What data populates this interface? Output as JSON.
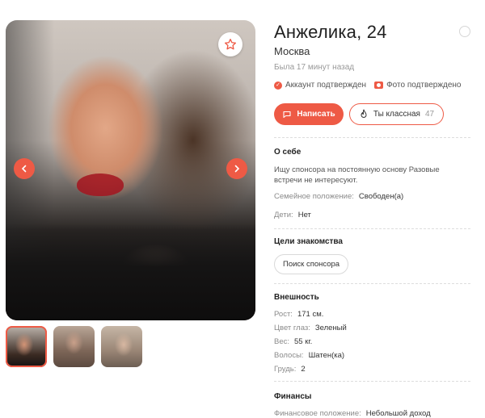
{
  "profile": {
    "name_age": "Анжелика, 24",
    "city": "Москва",
    "last_seen": "Была 17 минут назад",
    "badges": {
      "account_verified": "Аккаунт подтвержден",
      "photo_verified": "Фото подтверждено"
    }
  },
  "actions": {
    "write_label": "Написать",
    "cool_label": "Ты классная",
    "cool_count": "47"
  },
  "about": {
    "title": "О себе",
    "text": "Ищу спонсора на постоянную основу Разовые встречи не интересуют.",
    "marital_label": "Семейное положение:",
    "marital_value": "Свободен(а)",
    "kids_label": "Дети:",
    "kids_value": "Нет"
  },
  "goals": {
    "title": "Цели знакомства",
    "items": [
      "Поиск спонсора"
    ]
  },
  "appearance": {
    "title": "Внешность",
    "rows": [
      {
        "label": "Рост:",
        "value": "171 см."
      },
      {
        "label": "Цвет глаз:",
        "value": "Зеленый"
      },
      {
        "label": "Вес:",
        "value": "55 кг."
      },
      {
        "label": "Волосы:",
        "value": "Шатен(ка)"
      },
      {
        "label": "Грудь:",
        "value": "2"
      }
    ]
  },
  "finances": {
    "title": "Финансы",
    "label": "Финансовое положение:",
    "value": "Небольшой доход"
  },
  "colors": {
    "accent": "#ee5a45"
  }
}
